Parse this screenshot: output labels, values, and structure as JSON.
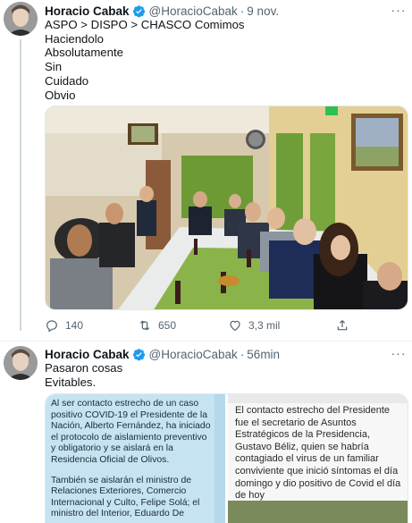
{
  "tweet1": {
    "author_name": "Horacio Cabak",
    "handle": "@HoracioCabak",
    "separator": "·",
    "time": "9 nov.",
    "lines": [
      "ASPO > DISPO > CHASCO Comimos",
      "Haciendolo",
      "Absolutamente",
      "Sin",
      "Cuidado",
      "Obvio"
    ],
    "actions": {
      "replies": "140",
      "retweets": "650",
      "likes": "3,3 mil"
    }
  },
  "tweet2": {
    "author_name": "Horacio Cabak",
    "handle": "@HoracioCabak",
    "separator": "·",
    "time": "56min",
    "lines": [
      "Pasaron cosas",
      "Evitables."
    ],
    "card_left_paragraphs": [
      "Al ser contacto estrecho de un caso positivo COVID-19 el Presidente de la Nación, Alberto Fernández, ha iniciado el protocolo de aislamiento preventivo y obligatorio y se aislará en la Residencia Oficial de Olivos.",
      "También se aislarán el ministro de Relaciones Exteriores, Comercio Internacional y Culto, Felipe Solá; el ministro del Interior, Eduardo De"
    ],
    "card_right_text": "El contacto estrecho del Presidente fue el secretario de Asuntos Estratégicos de la Presidencia, Gustavo Béliz, quien se habría contagiado el virus de un familiar conviviente que inició síntomas el día domingo y dio positivo de Covid el día de hoy"
  },
  "icons": {
    "verified": "verified-badge-icon",
    "more": "more-icon",
    "reply": "reply-icon",
    "retweet": "retweet-icon",
    "like": "like-icon",
    "share": "share-icon"
  },
  "colors": {
    "verified": "#1d9bf0",
    "text": "#0f1419",
    "secondary": "#536471",
    "card_blue": "#c6e3f2"
  }
}
